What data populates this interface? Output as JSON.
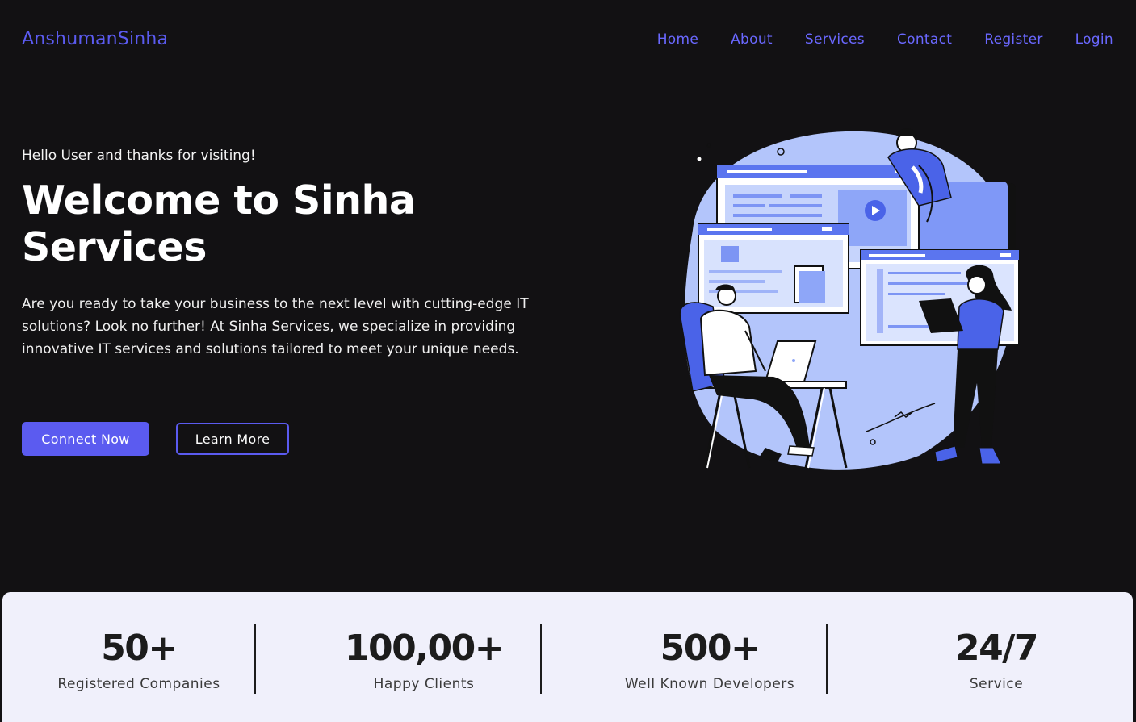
{
  "header": {
    "brand": "AnshumanSinha",
    "nav": [
      "Home",
      "About",
      "Services",
      "Contact",
      "Register",
      "Login"
    ]
  },
  "hero": {
    "greeting": "Hello User and thanks for visiting!",
    "headline": "Welcome to Sinha Services",
    "description": "Are you ready to take your business to the next level with cutting-edge IT solutions? Look no further! At Sinha Services, we specialize in providing innovative IT services and solutions tailored to meet your unique needs.",
    "primary_button": "Connect Now",
    "secondary_button": "Learn More"
  },
  "stats": [
    {
      "value": "50+",
      "label": "Registered Companies"
    },
    {
      "value": "100,00+",
      "label": "Happy Clients"
    },
    {
      "value": "500+",
      "label": "Well Known Developers"
    },
    {
      "value": "24/7",
      "label": "Service"
    }
  ],
  "colors": {
    "background": "#121113",
    "accent": "#5b5bf0",
    "stats_background": "#f0f0fb"
  }
}
